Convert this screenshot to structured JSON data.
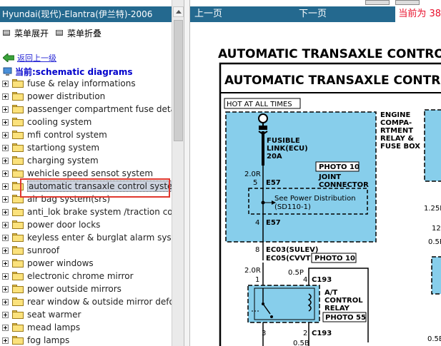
{
  "left_panel": {
    "title": "Hyundai(现代)-Elantra(伊兰特)-2006",
    "toolbar": {
      "expand_label": "菜单展开",
      "collapse_label": "菜单折叠"
    },
    "back_label": "返回上一级",
    "current_label": "当前:schematic diagrams",
    "tree_items": [
      "fuse & relay informations",
      "power distribution",
      "passenger compartment fuse detail",
      "cooling system",
      "mfi control system",
      "startiong system",
      "charging system",
      "wehicle speed sensot system",
      "automatic transaxle control system",
      "air bag system(srs)",
      "anti_lok brake system /traction con",
      "power door locks",
      "keyless enter & burglat alarm syste",
      "sunroof",
      "power windows",
      "electronic chrome mirror",
      "power outside mirrors",
      "rear window & outside mirror defog",
      "seat warmer",
      "mead lamps",
      "fog lamps"
    ],
    "selected_item": "automatic transaxle control system"
  },
  "nav": {
    "prev_label": "上一页",
    "next_label": "下一页",
    "current_page": "当前为 38"
  },
  "diagram": {
    "heading_outer": "AUTOMATIC TRANSAXLE CONTRO",
    "heading_inner": "AUTOMATIC TRANSAXLE CONTR",
    "hot_label": "HOT AT ALL TIMES",
    "fusible_link": [
      "FUSIBLE",
      "LINK(ECU)",
      "20A"
    ],
    "engine_box": [
      "ENGINE",
      "COMPA-",
      "RTMENT",
      "RELAY &",
      "FUSE BOX"
    ],
    "photo10_a": "PHOTO 10",
    "joint_connector": [
      "JOINT",
      "CONNECTOR"
    ],
    "wire_2r": "2.0R",
    "pin_5": "5",
    "e57_top": "E57",
    "see_power": [
      "See Power Distribution",
      "(SD110-1)"
    ],
    "pin_4": "4",
    "e57_bottom": "E57",
    "pin_8": "8",
    "ec03": "EC03(SULEV)",
    "ec05": "EC05(CVVT)",
    "photo10_b": "PHOTO 10",
    "wire_2r_b": "2.0R",
    "pin_1": "1",
    "wire_05p": "0.5P",
    "pin_4b": "4",
    "c193_a": "C193",
    "at_relay": [
      "A/T",
      "CONTROL",
      "RELAY"
    ],
    "photo55": "PHOTO 55",
    "pin_3": "3",
    "pin_2": "2",
    "c193_b": "C193",
    "wire_05b": "0.5B",
    "right_125b": "1.25B",
    "right_12": "12",
    "right_05p": "0.5P",
    "right_05b": "0.5B"
  },
  "colors": {
    "title_bar": "#24698f",
    "selection_box": "#e0382e",
    "diagram_fill": "#87ceeb",
    "page_counter": "#e8112d",
    "link": "#2a2ad6"
  }
}
